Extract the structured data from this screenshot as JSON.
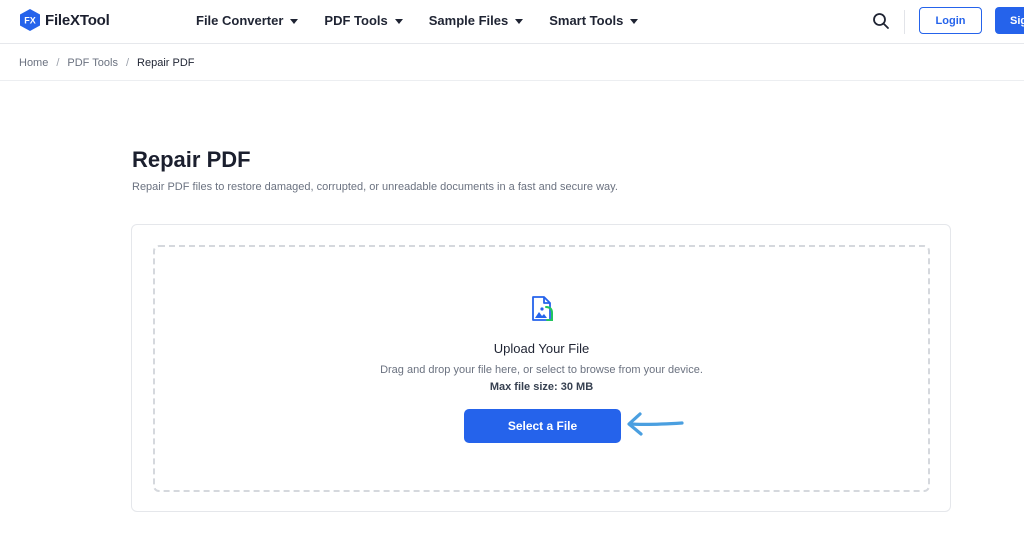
{
  "brand": {
    "logo_mark": "FX",
    "name": "FileXTool"
  },
  "nav": {
    "items": [
      {
        "label": "File Converter"
      },
      {
        "label": "PDF Tools"
      },
      {
        "label": "Sample Files"
      },
      {
        "label": "Smart Tools"
      }
    ],
    "search_icon": "search-icon",
    "login_label": "Login",
    "signup_label": "Sign Up"
  },
  "breadcrumb": {
    "items": [
      "Home",
      "PDF Tools"
    ],
    "current": "Repair PDF",
    "separator": "/"
  },
  "page": {
    "title": "Repair PDF",
    "subtitle": "Repair PDF files to restore damaged, corrupted, or unreadable documents in a fast and secure way."
  },
  "upload": {
    "icon": "file-image-icon",
    "title": "Upload Your File",
    "description": "Drag and drop your file here, or select to browse from your device.",
    "max_size": "Max file size: 30 MB",
    "button_label": "Select a File"
  },
  "colors": {
    "accent": "#2563eb",
    "annotation_arrow": "#4a9fe0",
    "icon_green": "#22c55e"
  }
}
